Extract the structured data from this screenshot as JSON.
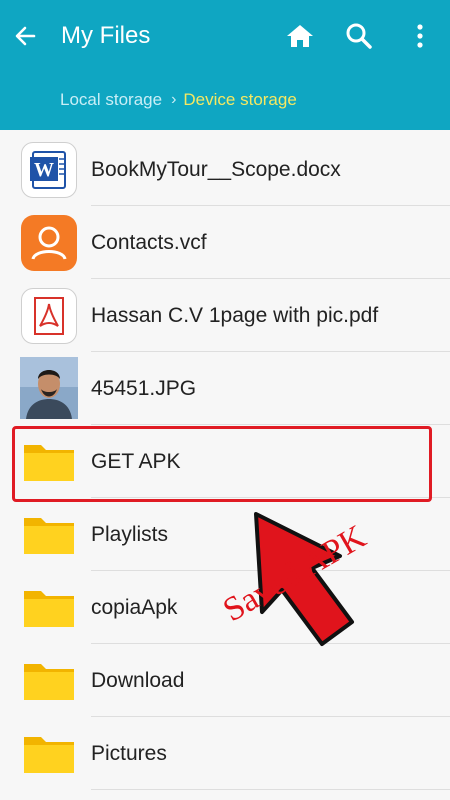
{
  "header": {
    "title": "My Files",
    "back_icon": "back-arrow-icon",
    "home_icon": "home-icon",
    "search_icon": "search-icon",
    "menu_icon": "more-vert-icon",
    "background": "#0fa6c2"
  },
  "breadcrumb": {
    "parent": "Local storage",
    "current": "Device storage",
    "current_color": "#f5e862"
  },
  "files": [
    {
      "name": "BookMyTour__Scope.docx",
      "icon": "word-doc-icon"
    },
    {
      "name": "Contacts.vcf",
      "icon": "contact-icon"
    },
    {
      "name": "Hassan C.V 1page with pic.pdf",
      "icon": "pdf-icon"
    },
    {
      "name": "45451.JPG",
      "icon": "photo-thumbnail"
    },
    {
      "name": "GET APK",
      "icon": "folder-icon"
    },
    {
      "name": "Playlists",
      "icon": "folder-icon"
    },
    {
      "name": "copiaApk",
      "icon": "folder-icon"
    },
    {
      "name": "Download",
      "icon": "folder-icon"
    },
    {
      "name": "Pictures",
      "icon": "folder-icon"
    }
  ],
  "annotation": {
    "text": "Saved APK",
    "color": "#e0141c"
  }
}
